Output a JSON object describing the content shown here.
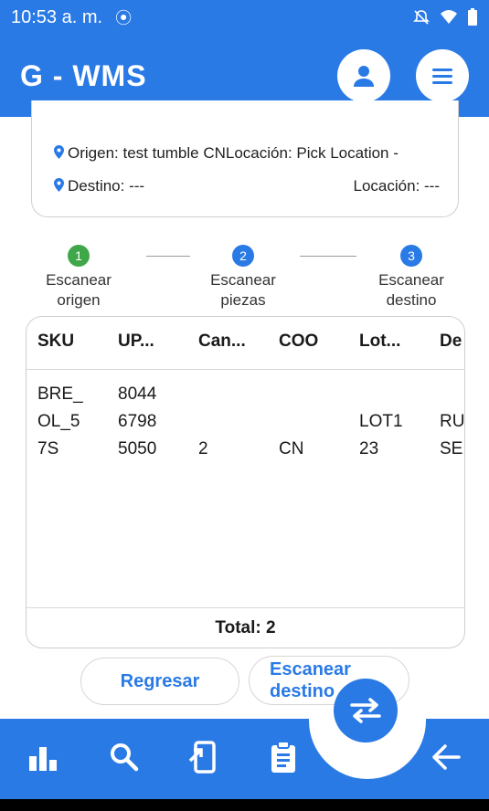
{
  "status_bar": {
    "time": "10:53 a. m.",
    "right_text": "◆ ▼ ▮"
  },
  "app": {
    "title": "G - WMS",
    "colors": {
      "primary": "#2a7ae6",
      "success": "#3fa74a"
    }
  },
  "info": {
    "origen": "Origen: test tumble CNLocación: Pick Location -",
    "destino": "Destino: ---",
    "destino_locacion": "Locación: ---"
  },
  "steps": [
    {
      "num": "1",
      "label1": "Escanear",
      "label2": "origen",
      "state": "done"
    },
    {
      "num": "2",
      "label1": "Escanear",
      "label2": "piezas",
      "state": "active"
    },
    {
      "num": "3",
      "label1": "Escanear",
      "label2": "destino",
      "state": "active"
    }
  ],
  "table": {
    "headers": [
      "SKU",
      "UP...",
      "Can...",
      "COO",
      "Lot...",
      "De"
    ],
    "rows": [
      {
        "sku": "BRE_\nOL_5\n7S",
        "upc": "8044\n6798\n5050",
        "cantidad": "2",
        "coo": "CN",
        "lote": "LOT1\n23",
        "desc": "RU\nSE"
      }
    ],
    "total": "Total: 2"
  },
  "buttons": {
    "back": "Regresar",
    "next_line1": "Escanear",
    "next_line2": "destino"
  },
  "bottom_nav": [
    "chart-icon",
    "search-icon",
    "phone-scan-icon",
    "clipboard-icon",
    "swap-icon",
    "arrow-left-icon"
  ]
}
